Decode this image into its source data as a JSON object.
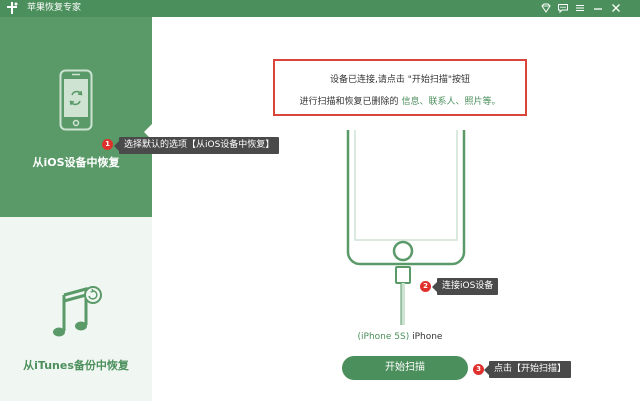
{
  "app": {
    "title": "苹果恢复专家"
  },
  "sidebar": {
    "items": [
      {
        "label": "从iOS设备中恢复",
        "active": true,
        "icon": "phone-sync-icon"
      },
      {
        "label": "从iTunes备份中恢复",
        "active": false,
        "icon": "music-note-icon"
      }
    ]
  },
  "notice": {
    "line1": "设备已连接,请点击 \"开始扫描\"按钮",
    "line2_prefix": "进行扫描和恢复已删除的",
    "line2_highlight": "信息、联系人、照片等。"
  },
  "device": {
    "model": "(iPhone 5S)",
    "kind": "iPhone"
  },
  "scan_button": {
    "label": "开始扫描"
  },
  "tips": [
    {
      "badge": "1",
      "text": "选择默认的选项【从iOS设备中恢复】"
    },
    {
      "badge": "2",
      "text": "连接iOS设备"
    },
    {
      "badge": "3",
      "text": "点击【开始扫描】"
    }
  ],
  "colors": {
    "brand": "#4b8f5c",
    "sidebar_active": "#5a9a69",
    "sidebar_bg": "#f0f6f1",
    "highlight_border": "#d9443d",
    "badge": "#e0302b",
    "tip_bg": "#4a4a4a"
  }
}
